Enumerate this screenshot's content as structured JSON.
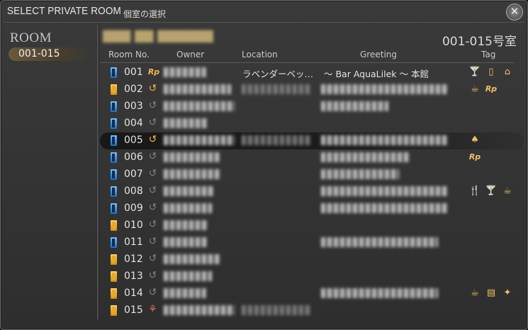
{
  "window": {
    "title": "SELECT PRIVATE ROOM",
    "subtitle": "個室の選択",
    "close_glyph": "✕"
  },
  "sidebar": {
    "heading": "ROOM",
    "items": [
      {
        "label": "001-015",
        "selected": true
      }
    ]
  },
  "main": {
    "room_range": "001-015号室",
    "columns": {
      "room_no": "Room No.",
      "owner": "Owner",
      "location": "Location",
      "greeting": "Greeting",
      "tag": "Tag"
    },
    "rows": [
      {
        "num": "001",
        "door": "blue",
        "status": "rp",
        "status_glyph": "Rp",
        "owner_blurred": true,
        "location": "ラベンダーベッ…",
        "greeting": "～ Bar AquaLilek ～ 本館",
        "tags": [
          "drink-icon",
          "door-icon",
          "house-icon"
        ]
      },
      {
        "num": "002",
        "door": "gold",
        "status": "busy",
        "status_glyph": "↺",
        "owner_blurred": true,
        "location_blurred": true,
        "greeting_blurred": true,
        "tags": [
          "cup-icon",
          "rp-icon"
        ]
      },
      {
        "num": "003",
        "door": "blue",
        "status": "idle",
        "status_glyph": "↺",
        "owner_blurred": true,
        "greeting_blurred": true,
        "tags": []
      },
      {
        "num": "004",
        "door": "blue",
        "status": "idle",
        "status_glyph": "↺",
        "owner_blurred": true,
        "tags": []
      },
      {
        "num": "005",
        "door": "blue",
        "status": "busy",
        "status_glyph": "↺",
        "selected": true,
        "owner_blurred": true,
        "location_blurred": true,
        "greeting_blurred": true,
        "tags": [
          "tree-icon"
        ]
      },
      {
        "num": "006",
        "door": "blue",
        "status": "idle",
        "status_glyph": "↺",
        "owner_blurred": true,
        "greeting_blurred": true,
        "tags": [
          "rp-icon"
        ]
      },
      {
        "num": "007",
        "door": "blue",
        "status": "idle",
        "status_glyph": "↺",
        "owner_blurred": true,
        "greeting_blurred": true,
        "tags": []
      },
      {
        "num": "008",
        "door": "blue",
        "status": "idle",
        "status_glyph": "↺",
        "owner_blurred": true,
        "greeting_blurred": true,
        "tags": [
          "cutlery-icon",
          "drink-icon",
          "cup-icon"
        ]
      },
      {
        "num": "009",
        "door": "blue",
        "status": "idle",
        "status_glyph": "↺",
        "owner_blurred": true,
        "greeting_blurred": true,
        "tags": []
      },
      {
        "num": "010",
        "door": "gold",
        "status": "idle",
        "status_glyph": "↺",
        "owner_blurred": true,
        "tags": []
      },
      {
        "num": "011",
        "door": "blue",
        "status": "idle",
        "status_glyph": "↺",
        "owner_blurred": true,
        "greeting_blurred": true,
        "tags": []
      },
      {
        "num": "012",
        "door": "gold",
        "status": "idle",
        "status_glyph": "↺",
        "owner_blurred": true,
        "tags": []
      },
      {
        "num": "013",
        "door": "gold",
        "status": "idle",
        "status_glyph": "↺",
        "owner_blurred": true,
        "tags": []
      },
      {
        "num": "014",
        "door": "gold",
        "status": "idle",
        "status_glyph": "↺",
        "owner_blurred": true,
        "greeting_blurred": true,
        "tags": [
          "cup-icon",
          "book-icon",
          "dancer-icon"
        ]
      },
      {
        "num": "015",
        "door": "gold",
        "status": "fig",
        "status_glyph": "⚘",
        "owner_blurred": true,
        "location_blurred": true,
        "tags": []
      }
    ]
  },
  "colors": {
    "accent_gold": "#f0c060",
    "door_blue": "#1a6fc0",
    "door_gold": "#e9a81e"
  },
  "icons": {
    "drink-icon": "🍸",
    "door-icon": "▯",
    "house-icon": "⌂",
    "cup-icon": "☕",
    "rp-icon": "Rp",
    "tree-icon": "♠",
    "cutlery-icon": "🍴",
    "book-icon": "▤",
    "dancer-icon": "✦"
  }
}
